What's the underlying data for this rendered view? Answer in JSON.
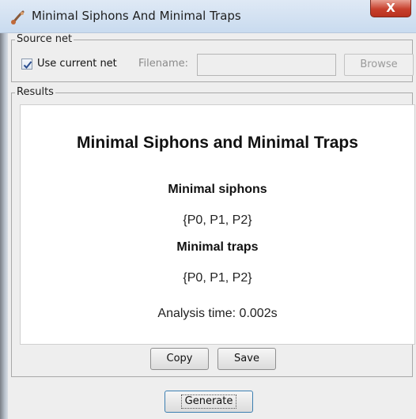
{
  "window": {
    "title": "Minimal Siphons And Minimal Traps",
    "close_glyph": "X"
  },
  "source_net": {
    "legend": "Source net",
    "use_current_label": "Use current net",
    "use_current_checked": true,
    "filename_label": "Filename:",
    "filename_value": "",
    "browse_label": "Browse"
  },
  "results": {
    "legend": "Results",
    "title": "Minimal Siphons and Minimal Traps",
    "siphons_heading": "Minimal siphons",
    "siphons_value": "{P0, P1, P2}",
    "traps_heading": "Minimal traps",
    "traps_value": "{P0, P1, P2}",
    "analysis_time": "Analysis time: 0.002s",
    "copy_label": "Copy",
    "save_label": "Save"
  },
  "footer": {
    "generate_label": "Generate"
  },
  "icons": {
    "app": "petri-net-app-icon",
    "close": "close-icon",
    "check": "checkmark-icon"
  },
  "colors": {
    "close_button": "#c7402d",
    "titlebar": "#c9dbef",
    "focus_border": "#3c7fb1"
  }
}
